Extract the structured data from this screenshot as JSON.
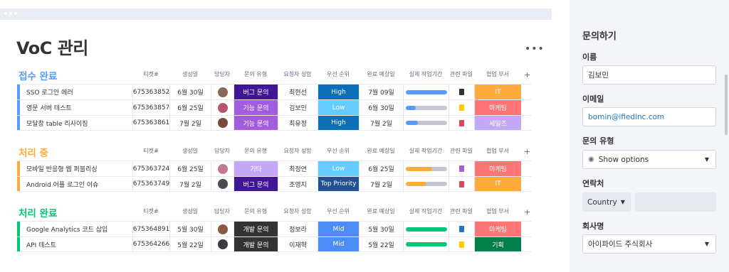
{
  "board": {
    "title": "VoC 관리",
    "more_label": "•••",
    "headers": [
      "티켓#",
      "생성일",
      "담당자",
      "문의 유형",
      "요청자 성함",
      "우선 순위",
      "완료 예상일",
      "실제 작업기간",
      "관련 파일",
      "협업 부서"
    ],
    "add_column_label": "+",
    "groups": [
      {
        "name": "접수 완료",
        "color": "#579bfc",
        "rows": [
          {
            "name": "SSO 로그인 에러",
            "ticket": "675363852",
            "created": "6월 30일",
            "owner_color": "#8a6a55",
            "type": "버그 문의",
            "type_color": "#401694",
            "requester": "최현선",
            "priority": "High",
            "priority_color": "#0a6fb8",
            "due": "7월 09일",
            "progress": 1.0,
            "progress_color": "#579bfc",
            "file_icon": "document-icon",
            "file_color": "#323338",
            "dept": "IT",
            "dept_color": "#fdab3d"
          },
          {
            "name": "영문 서버 테스트",
            "ticket": "675363857",
            "created": "6월 25일",
            "owner_color": "#b5566e",
            "type": "기능 문의",
            "type_color": "#a25ddc",
            "requester": "김보민",
            "priority": "Low",
            "priority_color": "#66ccff",
            "due": "6월 30일",
            "progress": 0.25,
            "progress_color": "#579bfc",
            "file_icon": "note-icon",
            "file_color": "#ffcb00",
            "dept": "마케팅",
            "dept_color": "#ff7575"
          },
          {
            "name": "모달창 table 리사이징",
            "ticket": "675363861",
            "created": "7월 2일",
            "owner_color": "#7a4a3a",
            "type": "기능 문의",
            "type_color": "#a25ddc",
            "requester": "최유정",
            "priority": "High",
            "priority_color": "#0a6fb8",
            "due": "7월 2일",
            "progress": 0.3,
            "progress_color": "#579bfc",
            "file_icon": "pdf-icon",
            "file_color": "#e2445c",
            "dept": "세일즈",
            "dept_color": "#c4a8f5"
          }
        ]
      },
      {
        "name": "처리 중",
        "color": "#fdab3d",
        "rows": [
          {
            "name": "모바일 반응형 웹 퍼블리싱",
            "ticket": "675363724",
            "created": "6월 25일",
            "owner_color": "#c27a93",
            "type": "기타",
            "type_color": "#c4a8f5",
            "requester": "최정연",
            "priority": "Low",
            "priority_color": "#66ccff",
            "due": "6월 25일",
            "progress": 0.65,
            "progress_color": "#fdab3d",
            "file_icon": "form-icon",
            "file_color": "#a25ddc",
            "dept": "마케팅",
            "dept_color": "#ff7575"
          },
          {
            "name": "Android 어플 로그인 이슈",
            "ticket": "675363749",
            "created": "7월 2일",
            "owner_color": "#4a4a55",
            "type": "버그 문의",
            "type_color": "#401694",
            "requester": "조영지",
            "priority": "Top Priority",
            "priority_color": "#225091",
            "due": "7월 2일",
            "progress": 0.5,
            "progress_color": "#fdab3d",
            "file_icon": "pdf-icon",
            "file_color": "#e2445c",
            "dept": "IT",
            "dept_color": "#fdab3d"
          }
        ]
      },
      {
        "name": "처리 완료",
        "color": "#00c875",
        "rows": [
          {
            "name": "Google Analytics 코드 삽입",
            "ticket": "675364891",
            "created": "5월 30일",
            "owner_color": "#8a5a44",
            "type": "개발 문의",
            "type_color": "#333333",
            "requester": "정보라",
            "priority": "Mid",
            "priority_color": "#4b8cf5",
            "due": "5월 30일",
            "progress": 1.0,
            "progress_color": "#00c875",
            "file_icon": "sheets-icon",
            "file_color": "#1f76c2",
            "dept": "마케팅",
            "dept_color": "#ff7575"
          },
          {
            "name": "API 테스트",
            "ticket": "675364266",
            "created": "5월 22일",
            "owner_color": "#3a3a40",
            "type": "개발 문의",
            "type_color": "#333333",
            "requester": "이재혁",
            "priority": "Mid",
            "priority_color": "#4b8cf5",
            "due": "5월 22일",
            "progress": 1.0,
            "progress_color": "#00c875",
            "file_icon": "note-icon",
            "file_color": "#ffcb00",
            "dept": "기획",
            "dept_color": "#037f4c"
          }
        ]
      }
    ]
  },
  "form": {
    "title": "문의하기",
    "name_label": "이름",
    "name_value": "김보민",
    "email_label": "이메일",
    "email_value": "bomin@ifiedinc.com",
    "type_label": "문의 유형",
    "type_value": "Show options",
    "contact_label": "연락처",
    "country_value": "Country",
    "company_label": "회사명",
    "company_value": "아이파이드 주식회사"
  }
}
